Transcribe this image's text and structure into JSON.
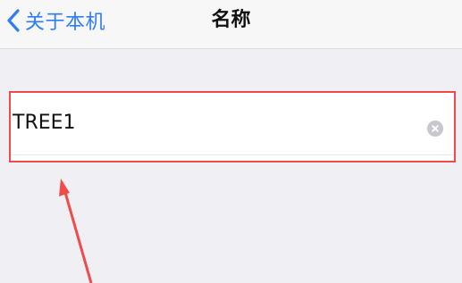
{
  "navbar": {
    "back_label": "关于本机",
    "title": "名称"
  },
  "name_field": {
    "value": "TREE1"
  },
  "icons": {
    "back": "chevron-left-icon",
    "clear": "clear-circle-icon"
  },
  "colors": {
    "accent": "#2f7cf6",
    "annotation": "#ef4b4b",
    "background": "#efeff4"
  }
}
